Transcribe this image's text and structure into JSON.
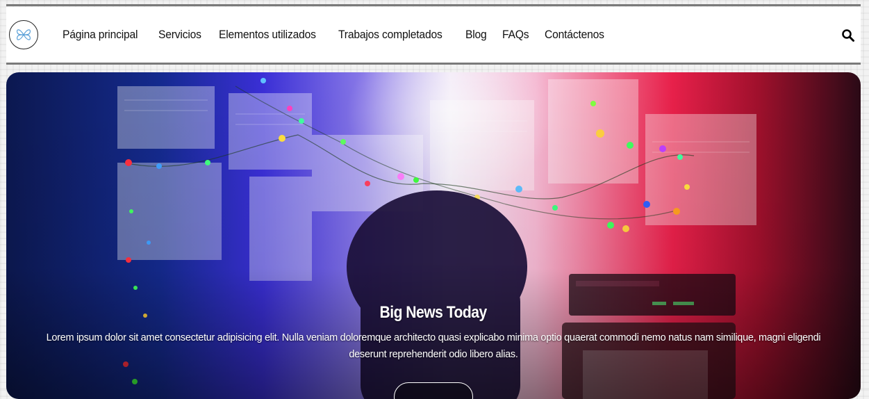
{
  "header": {
    "logo_icon": "butterfly-logo-icon",
    "nav": [
      {
        "label": "Página principal"
      },
      {
        "label": "Servicios"
      },
      {
        "label": "Elementos utilizados"
      },
      {
        "label": "Trabajos completados"
      },
      {
        "label": "Blog"
      },
      {
        "label": "FAQs"
      },
      {
        "label": "Contáctenos"
      }
    ],
    "search_icon": "search-icon"
  },
  "hero": {
    "title": "Big News Today",
    "text": "Lorem ipsum dolor sit amet consectetur adipisicing elit. Nulla veniam doloremque architecto quasi explicabo minima optio quaerat commodi nemo natus nam similique, magni eligendi deserunt reprehenderit odio libero alias."
  },
  "colors": {
    "rule": "#7a7a7a",
    "nav_text": "#111111",
    "hero_text": "#ffffff"
  }
}
